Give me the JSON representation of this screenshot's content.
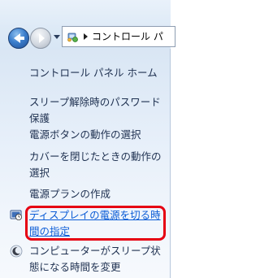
{
  "address_bar": {
    "icon": "control-panel-icon",
    "path_text": "コントロール パ"
  },
  "sidebar": {
    "home_label": "コントロール パネル ホーム",
    "items": [
      {
        "line1": "スリープ解除時のパスワード",
        "line2": "保護"
      },
      {
        "line1": "電源ボタンの動作の選択"
      },
      {
        "line1": "カバーを閉じたときの動作の",
        "line2": "選択"
      },
      {
        "line1": "電源プランの作成"
      },
      {
        "line1": "ディスプレイの電源を切る時",
        "line2": "間の指定",
        "icon": "display-timer-icon",
        "highlighted": true
      },
      {
        "line1": "コンピューターがスリープ状",
        "line2": "態になる時間を変更",
        "icon": "moon-sleep-icon"
      }
    ]
  },
  "colors": {
    "link": "#1e3050",
    "active_link": "#0b5cd6",
    "highlight": "#e60012"
  }
}
